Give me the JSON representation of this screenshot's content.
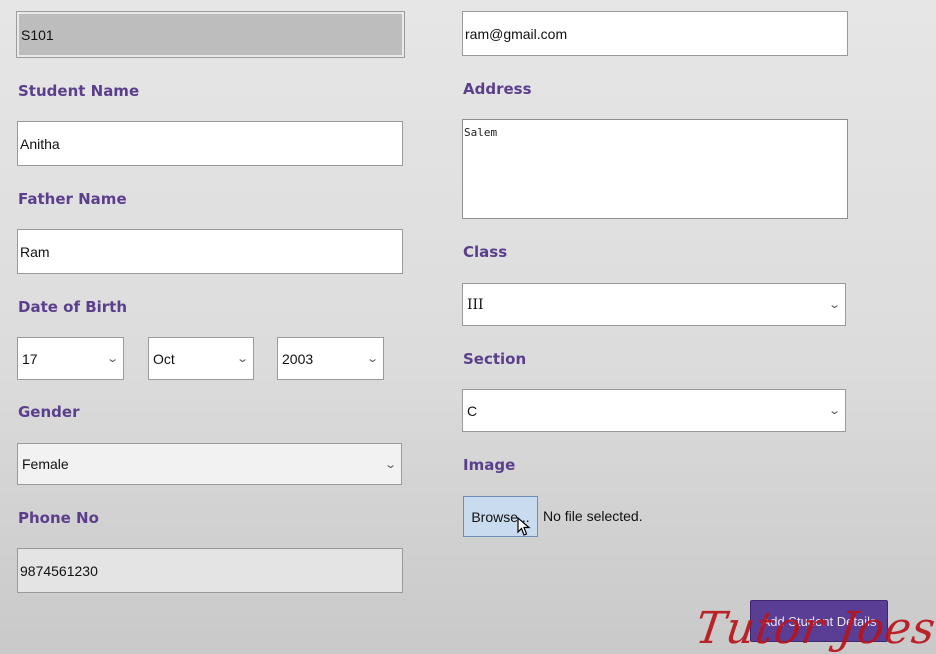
{
  "form": {
    "student_id": "S101",
    "student_name": {
      "label": "Student Name",
      "value": "Anitha"
    },
    "father_name": {
      "label": "Father Name",
      "value": "Ram"
    },
    "dob": {
      "label": "Date of Birth",
      "day": "17",
      "month": "Oct",
      "year": "2003"
    },
    "gender": {
      "label": "Gender",
      "value": "Female"
    },
    "phone": {
      "label": "Phone No",
      "value": "9874561230"
    },
    "email": {
      "value": "ram@gmail.com"
    },
    "address": {
      "label": "Address",
      "value": "Salem"
    },
    "class": {
      "label": "Class",
      "value": "III"
    },
    "section": {
      "label": "Section",
      "value": "C"
    },
    "image": {
      "label": "Image",
      "browse_label": "Browse...",
      "status": "No file selected."
    },
    "submit_label": "Add Student Details"
  },
  "watermark": "Tutor Joes",
  "icons": {
    "dropdown": "chevron-down-icon",
    "cursor": "mouse-pointer-icon"
  },
  "colors": {
    "label": "#5b3f8c",
    "button": "#5a3d94",
    "watermark": "#b8141c"
  }
}
